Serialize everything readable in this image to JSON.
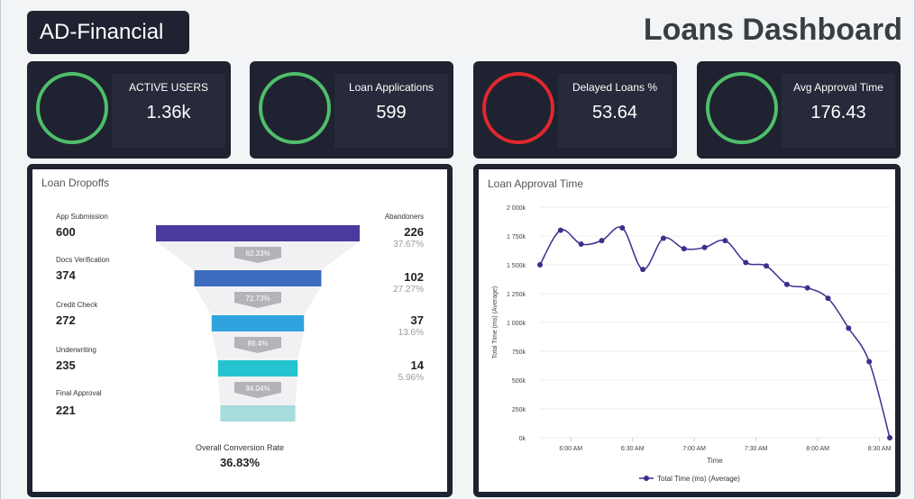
{
  "header": {
    "brand": "AD-Financial",
    "title": "Loans Dashboard"
  },
  "kpis": [
    {
      "label": "ACTIVE USERS",
      "value": "1.36k",
      "ring_color": "#4fbf6a"
    },
    {
      "label": "Loan Applications",
      "value": "599",
      "ring_color": "#4fbf6a"
    },
    {
      "label": "Delayed Loans %",
      "value": "53.64",
      "ring_color": "#e0282e"
    },
    {
      "label": "Avg Approval Time",
      "value": "176.43",
      "ring_color": "#4fbf6a"
    }
  ],
  "funnel": {
    "title": "Loan Dropoffs",
    "abandoners_label": "Abandoners",
    "stages": [
      {
        "label": "App Submission",
        "count": "600",
        "color": "#4a3a9e"
      },
      {
        "label": "Docs Verification",
        "count": "374",
        "color": "#3a6bbf"
      },
      {
        "label": "Credit Check",
        "count": "272",
        "color": "#2fa3dd"
      },
      {
        "label": "Underwriting",
        "count": "235",
        "color": "#25c3cf"
      },
      {
        "label": "Final Approval",
        "count": "221",
        "color": "#a7dcdc"
      }
    ],
    "conversions": [
      "62.33%",
      "72.73%",
      "86.4%",
      "94.04%"
    ],
    "abandoners": [
      {
        "count": "226",
        "pct": "37.67%"
      },
      {
        "count": "102",
        "pct": "27.27%"
      },
      {
        "count": "37",
        "pct": "13.6%"
      },
      {
        "count": "14",
        "pct": "5.96%"
      }
    ],
    "overall_label": "Overall Conversion Rate",
    "overall_value": "36.83%"
  },
  "chart_data": {
    "type": "line",
    "title": "Loan Approval Time",
    "xlabel": "Time",
    "ylabel": "Total Time (ms) (Average)",
    "x_ticks": [
      "6:00 AM",
      "6:30 AM",
      "7:00 AM",
      "7:30 AM",
      "8:00 AM",
      "8:30 AM"
    ],
    "y_ticks": [
      "0k",
      "250k",
      "500k",
      "750k",
      "1 000k",
      "1 250k",
      "1 500k",
      "1 750k",
      "2 000k"
    ],
    "ylim": [
      0,
      2000000
    ],
    "xlim_minutes_from_first_tick": [
      -15,
      155
    ],
    "legend": "Total Time (ms) (Average)",
    "legend_position": "bottom",
    "series_color": "#3b2f8f",
    "series": [
      {
        "name": "Total Time (ms) (Average)",
        "x": [
          "5:45 AM",
          "5:55 AM",
          "6:05 AM",
          "6:15 AM",
          "6:25 AM",
          "6:35 AM",
          "6:45 AM",
          "6:55 AM",
          "7:05 AM",
          "7:15 AM",
          "7:25 AM",
          "7:35 AM",
          "7:45 AM",
          "7:55 AM",
          "8:05 AM",
          "8:15 AM",
          "8:25 AM",
          "8:35 AM"
        ],
        "values": [
          1500000,
          1800000,
          1680000,
          1710000,
          1820000,
          1460000,
          1730000,
          1640000,
          1650000,
          1710000,
          1520000,
          1490000,
          1330000,
          1300000,
          1210000,
          950000,
          660000,
          0
        ]
      }
    ]
  }
}
